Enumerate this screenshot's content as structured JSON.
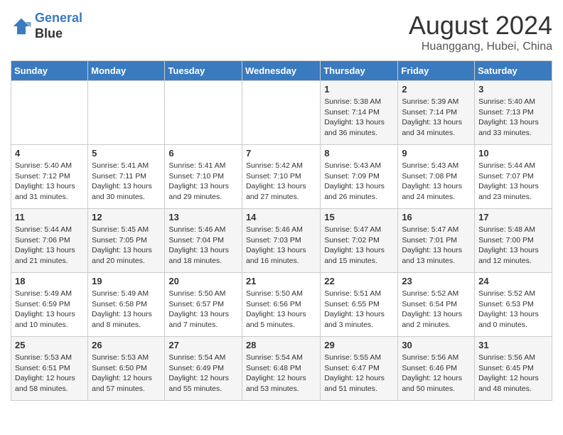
{
  "header": {
    "logo_line1": "General",
    "logo_line2": "Blue",
    "month_year": "August 2024",
    "location": "Huanggang, Hubei, China"
  },
  "weekdays": [
    "Sunday",
    "Monday",
    "Tuesday",
    "Wednesday",
    "Thursday",
    "Friday",
    "Saturday"
  ],
  "weeks": [
    [
      {
        "day": "",
        "info": ""
      },
      {
        "day": "",
        "info": ""
      },
      {
        "day": "",
        "info": ""
      },
      {
        "day": "",
        "info": ""
      },
      {
        "day": "1",
        "info": "Sunrise: 5:38 AM\nSunset: 7:14 PM\nDaylight: 13 hours\nand 36 minutes."
      },
      {
        "day": "2",
        "info": "Sunrise: 5:39 AM\nSunset: 7:14 PM\nDaylight: 13 hours\nand 34 minutes."
      },
      {
        "day": "3",
        "info": "Sunrise: 5:40 AM\nSunset: 7:13 PM\nDaylight: 13 hours\nand 33 minutes."
      }
    ],
    [
      {
        "day": "4",
        "info": "Sunrise: 5:40 AM\nSunset: 7:12 PM\nDaylight: 13 hours\nand 31 minutes."
      },
      {
        "day": "5",
        "info": "Sunrise: 5:41 AM\nSunset: 7:11 PM\nDaylight: 13 hours\nand 30 minutes."
      },
      {
        "day": "6",
        "info": "Sunrise: 5:41 AM\nSunset: 7:10 PM\nDaylight: 13 hours\nand 29 minutes."
      },
      {
        "day": "7",
        "info": "Sunrise: 5:42 AM\nSunset: 7:10 PM\nDaylight: 13 hours\nand 27 minutes."
      },
      {
        "day": "8",
        "info": "Sunrise: 5:43 AM\nSunset: 7:09 PM\nDaylight: 13 hours\nand 26 minutes."
      },
      {
        "day": "9",
        "info": "Sunrise: 5:43 AM\nSunset: 7:08 PM\nDaylight: 13 hours\nand 24 minutes."
      },
      {
        "day": "10",
        "info": "Sunrise: 5:44 AM\nSunset: 7:07 PM\nDaylight: 13 hours\nand 23 minutes."
      }
    ],
    [
      {
        "day": "11",
        "info": "Sunrise: 5:44 AM\nSunset: 7:06 PM\nDaylight: 13 hours\nand 21 minutes."
      },
      {
        "day": "12",
        "info": "Sunrise: 5:45 AM\nSunset: 7:05 PM\nDaylight: 13 hours\nand 20 minutes."
      },
      {
        "day": "13",
        "info": "Sunrise: 5:46 AM\nSunset: 7:04 PM\nDaylight: 13 hours\nand 18 minutes."
      },
      {
        "day": "14",
        "info": "Sunrise: 5:46 AM\nSunset: 7:03 PM\nDaylight: 13 hours\nand 16 minutes."
      },
      {
        "day": "15",
        "info": "Sunrise: 5:47 AM\nSunset: 7:02 PM\nDaylight: 13 hours\nand 15 minutes."
      },
      {
        "day": "16",
        "info": "Sunrise: 5:47 AM\nSunset: 7:01 PM\nDaylight: 13 hours\nand 13 minutes."
      },
      {
        "day": "17",
        "info": "Sunrise: 5:48 AM\nSunset: 7:00 PM\nDaylight: 13 hours\nand 12 minutes."
      }
    ],
    [
      {
        "day": "18",
        "info": "Sunrise: 5:49 AM\nSunset: 6:59 PM\nDaylight: 13 hours\nand 10 minutes."
      },
      {
        "day": "19",
        "info": "Sunrise: 5:49 AM\nSunset: 6:58 PM\nDaylight: 13 hours\nand 8 minutes."
      },
      {
        "day": "20",
        "info": "Sunrise: 5:50 AM\nSunset: 6:57 PM\nDaylight: 13 hours\nand 7 minutes."
      },
      {
        "day": "21",
        "info": "Sunrise: 5:50 AM\nSunset: 6:56 PM\nDaylight: 13 hours\nand 5 minutes."
      },
      {
        "day": "22",
        "info": "Sunrise: 5:51 AM\nSunset: 6:55 PM\nDaylight: 13 hours\nand 3 minutes."
      },
      {
        "day": "23",
        "info": "Sunrise: 5:52 AM\nSunset: 6:54 PM\nDaylight: 13 hours\nand 2 minutes."
      },
      {
        "day": "24",
        "info": "Sunrise: 5:52 AM\nSunset: 6:53 PM\nDaylight: 13 hours\nand 0 minutes."
      }
    ],
    [
      {
        "day": "25",
        "info": "Sunrise: 5:53 AM\nSunset: 6:51 PM\nDaylight: 12 hours\nand 58 minutes."
      },
      {
        "day": "26",
        "info": "Sunrise: 5:53 AM\nSunset: 6:50 PM\nDaylight: 12 hours\nand 57 minutes."
      },
      {
        "day": "27",
        "info": "Sunrise: 5:54 AM\nSunset: 6:49 PM\nDaylight: 12 hours\nand 55 minutes."
      },
      {
        "day": "28",
        "info": "Sunrise: 5:54 AM\nSunset: 6:48 PM\nDaylight: 12 hours\nand 53 minutes."
      },
      {
        "day": "29",
        "info": "Sunrise: 5:55 AM\nSunset: 6:47 PM\nDaylight: 12 hours\nand 51 minutes."
      },
      {
        "day": "30",
        "info": "Sunrise: 5:56 AM\nSunset: 6:46 PM\nDaylight: 12 hours\nand 50 minutes."
      },
      {
        "day": "31",
        "info": "Sunrise: 5:56 AM\nSunset: 6:45 PM\nDaylight: 12 hours\nand 48 minutes."
      }
    ]
  ]
}
